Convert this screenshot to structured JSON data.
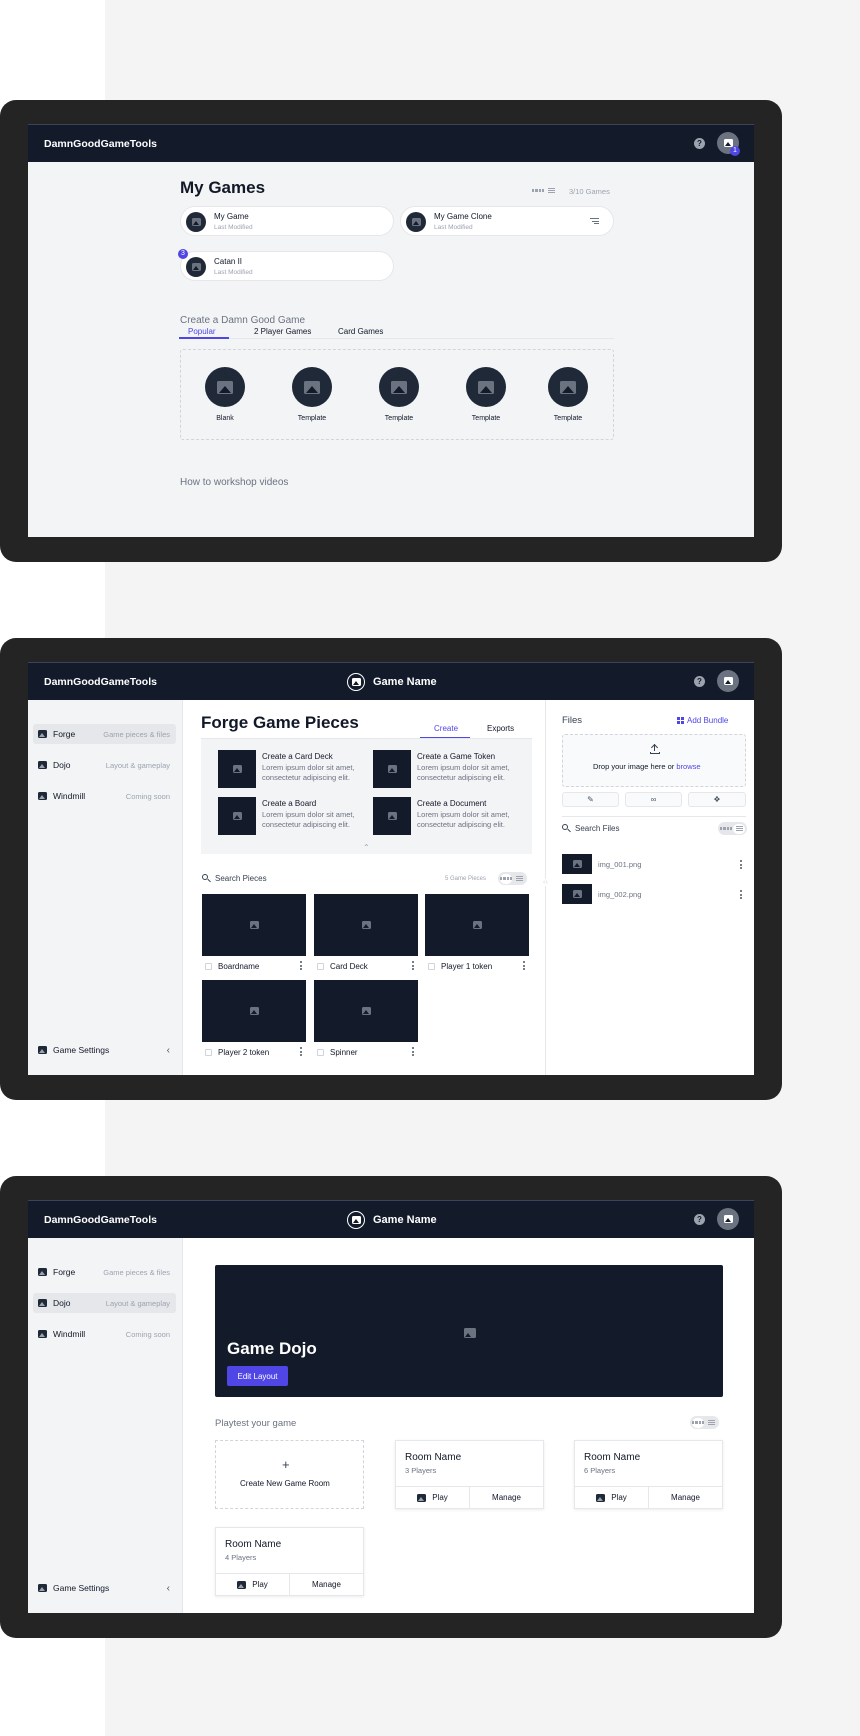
{
  "app": {
    "brand": "DamnGoodGameTools",
    "help_glyph": "?",
    "project_name": "Game Name"
  },
  "screen1": {
    "title": "My Games",
    "count": "3/10 Games",
    "avatar_badge": "1",
    "games": [
      {
        "name": "My Game",
        "sub": "Last Modified"
      },
      {
        "name": "My Game Clone",
        "sub": "Last Modified"
      },
      {
        "name": "Catan II",
        "sub": "Last Modified",
        "badge": "3"
      }
    ],
    "create_heading": "Create a Damn Good Game",
    "tabs": [
      "Popular",
      "2 Player Games",
      "Card Games"
    ],
    "templates": [
      "Blank",
      "Template",
      "Template",
      "Template",
      "Template"
    ],
    "videos_heading": "How to workshop videos"
  },
  "sidebar": {
    "items": [
      {
        "name": "Forge",
        "desc": "Game pieces & files"
      },
      {
        "name": "Dojo",
        "desc": "Layout & gameplay"
      },
      {
        "name": "Windmill",
        "desc": "Coming soon"
      }
    ],
    "settings": "Game Settings",
    "collapse_glyph": "‹"
  },
  "screen2": {
    "title": "Forge Game Pieces",
    "tabs": [
      "Create",
      "Exports"
    ],
    "create_items": [
      {
        "title": "Create a Card Deck",
        "desc": "Lorem ipsum dolor sit amet, consectetur adipiscing elit."
      },
      {
        "title": "Create a Game Token",
        "desc": "Lorem ipsum dolor sit amet, consectetur adipiscing elit."
      },
      {
        "title": "Create a Board",
        "desc": "Lorem ipsum dolor sit amet, consectetur adipiscing elit."
      },
      {
        "title": "Create a Document",
        "desc": "Lorem ipsum dolor sit amet, consectetur adipiscing elit."
      }
    ],
    "collapse_glyph": "⌃",
    "search_placeholder": "Search Pieces",
    "pieces_count": "5 Game Pieces",
    "pieces": [
      "Boardname",
      "Card Deck",
      "Player 1 token",
      "Player 2 token",
      "Spinner"
    ],
    "files": {
      "title": "Files",
      "add_bundle": "Add Bundle",
      "drop_text": "Drop your image here or",
      "browse": "browse",
      "search_placeholder": "Search Files",
      "items": [
        "img_001.png",
        "img_002.png"
      ]
    }
  },
  "screen3": {
    "hero_title": "Game Dojo",
    "edit_button": "Edit Layout",
    "playtest_heading": "Playtest your game",
    "create_room_plus": "+",
    "create_room": "Create New Game Room",
    "rooms": [
      {
        "name": "Room Name",
        "players": "3 Players"
      },
      {
        "name": "Room Name",
        "players": "6 Players"
      },
      {
        "name": "Room Name",
        "players": "4 Players"
      }
    ],
    "play": "Play",
    "manage": "Manage"
  },
  "colors": {
    "accent": "#4f46e5",
    "navy": "#131a2a"
  }
}
